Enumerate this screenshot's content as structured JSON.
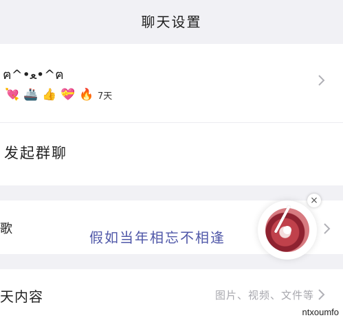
{
  "header": {
    "title": "聊天设置"
  },
  "profile": {
    "nickname": "ฅ^•ﻌ•^ฅ",
    "badges": [
      {
        "icon": "heart-lock-icon",
        "glyph": "💘"
      },
      {
        "icon": "ship-icon",
        "glyph": "🚢"
      },
      {
        "icon": "thumbs-up-icon",
        "glyph": "👍"
      },
      {
        "icon": "heart-cake-icon",
        "glyph": "💝"
      },
      {
        "icon": "flame-icon",
        "glyph": "🔥"
      }
    ],
    "streak_text": "7天"
  },
  "group_chat": {
    "label": "发起群聊"
  },
  "music": {
    "label": "歌",
    "lyric": "假如当年相忘不相逢"
  },
  "player": {
    "close_label": "×"
  },
  "history": {
    "label": "天内容",
    "hint": "图片、视频、文件等"
  },
  "watermark": "ntxoumfo",
  "colors": {
    "lyric": "#4f57a8",
    "background": "#f1f1f5",
    "card": "#ffffff"
  }
}
